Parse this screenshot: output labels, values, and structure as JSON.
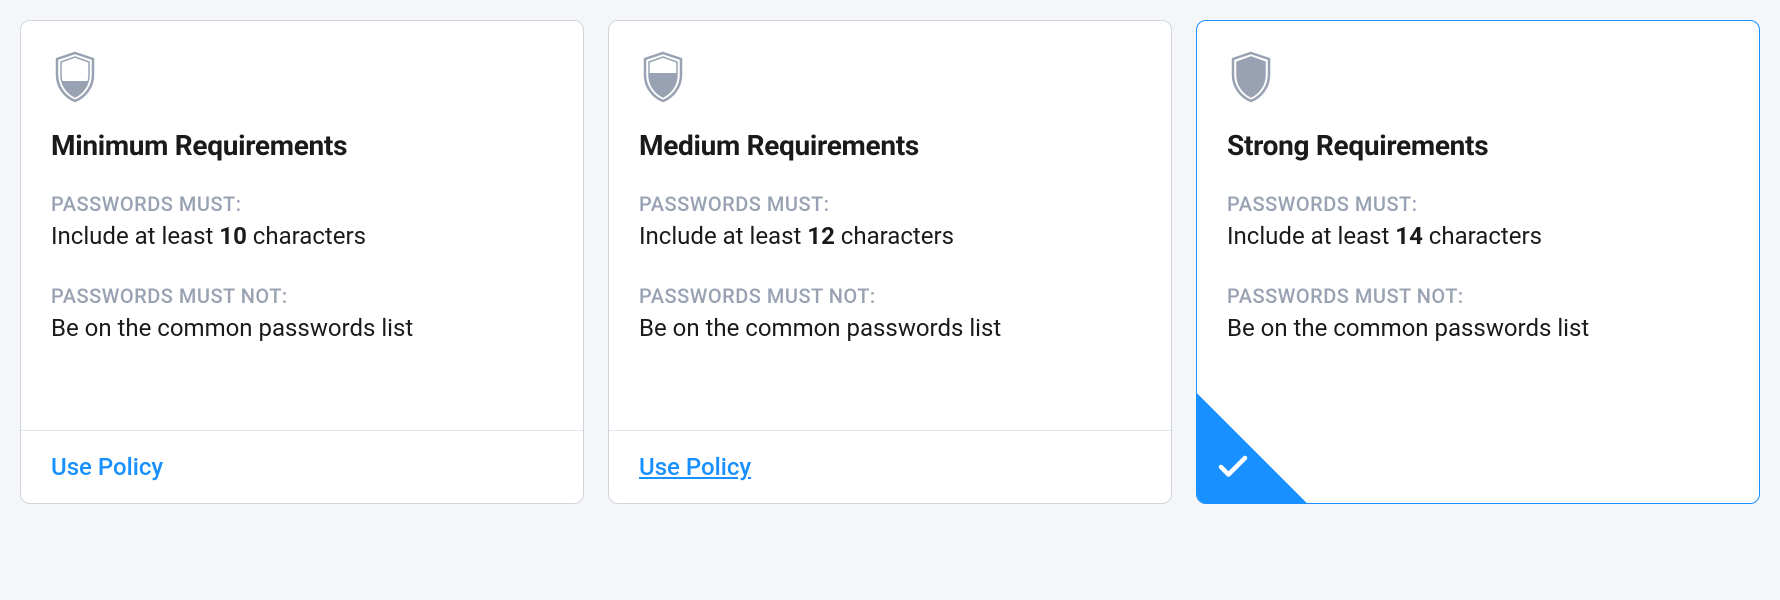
{
  "labels": {
    "must_header": "PASSWORDS MUST:",
    "must_not_header": "PASSWORDS MUST NOT:",
    "use_policy": "Use Policy",
    "include_prefix": "Include at least ",
    "include_suffix": " characters",
    "common_list": "Be on the common passwords list"
  },
  "cards": [
    {
      "id": "minimum",
      "title": "Minimum Requirements",
      "min_chars": "10",
      "shield_fill_level": "low",
      "selected": false
    },
    {
      "id": "medium",
      "title": "Medium Requirements",
      "min_chars": "12",
      "shield_fill_level": "medium",
      "selected": false
    },
    {
      "id": "strong",
      "title": "Strong Requirements",
      "min_chars": "14",
      "shield_fill_level": "high",
      "selected": true
    }
  ]
}
